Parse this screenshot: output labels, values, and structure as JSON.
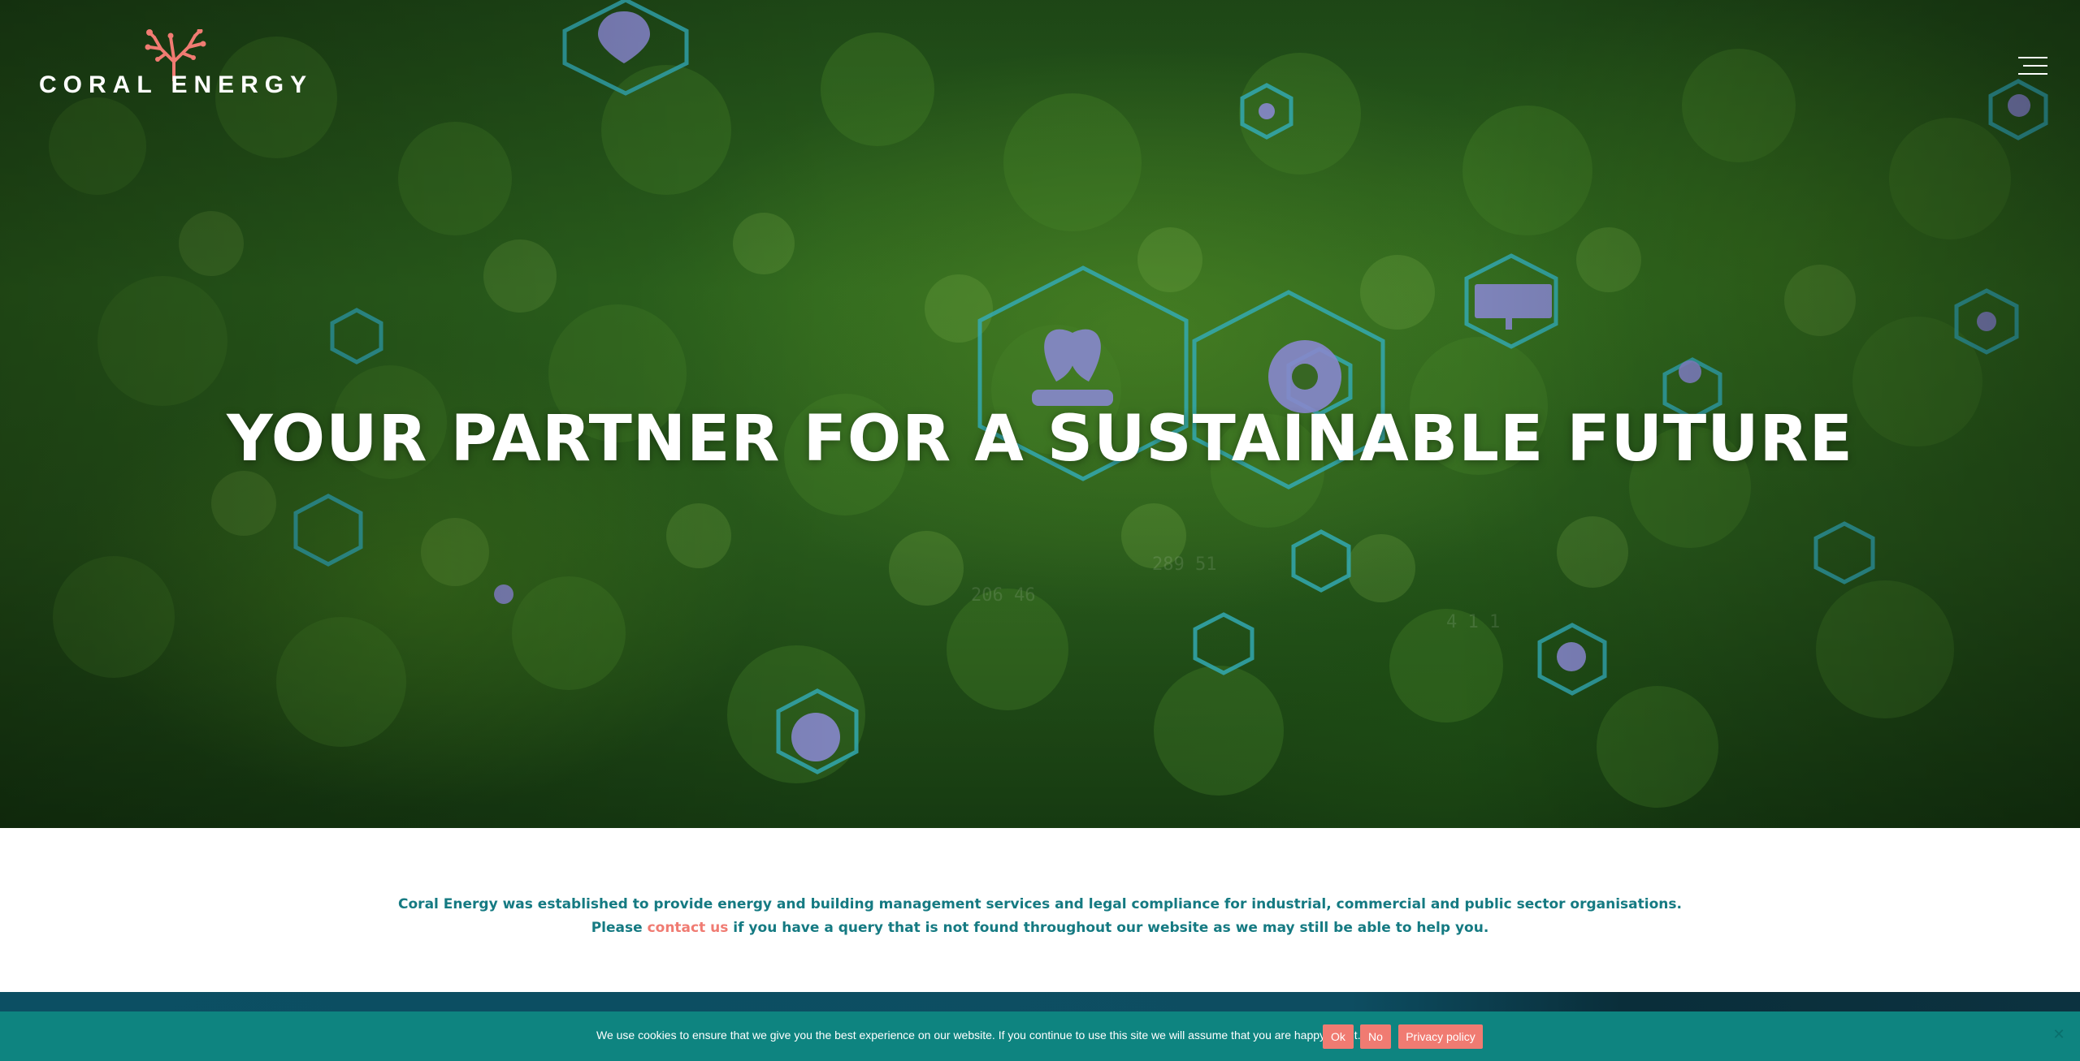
{
  "brand": {
    "name": "CORAL ENERGY",
    "accent_color": "#f07b72",
    "teal_color": "#157a82"
  },
  "header": {
    "menu_icon": "hamburger-menu-icon"
  },
  "hero": {
    "title": "YOUR PARTNER FOR A SUSTAINABLE FUTURE",
    "overlay_icons": [
      "leaf-hand-icon",
      "gear-leaf-icon",
      "solar-panel-icon",
      "map-pin-icon",
      "recycle-icon",
      "water-drop-icon",
      "wind-turbine-icon",
      "pie-chart-icon",
      "globe-icon",
      "electric-car-icon",
      "factory-icon"
    ]
  },
  "intro": {
    "line1": "Coral Energy was established to provide energy and building management services and legal compliance for industrial, commercial and public sector organisations.",
    "line2_before": "Please ",
    "line2_link": "contact us",
    "line2_after": " if you have a query that is not found throughout our website as we may still be able to help you."
  },
  "cookie_bar": {
    "message": "We use cookies to ensure that we give you the best experience on our website. If you continue to use this site we will assume that you are happy with it.",
    "ok_label": "Ok",
    "no_label": "No",
    "privacy_label": "Privacy policy",
    "close_icon": "close-icon",
    "background_color": "#0e8480"
  }
}
